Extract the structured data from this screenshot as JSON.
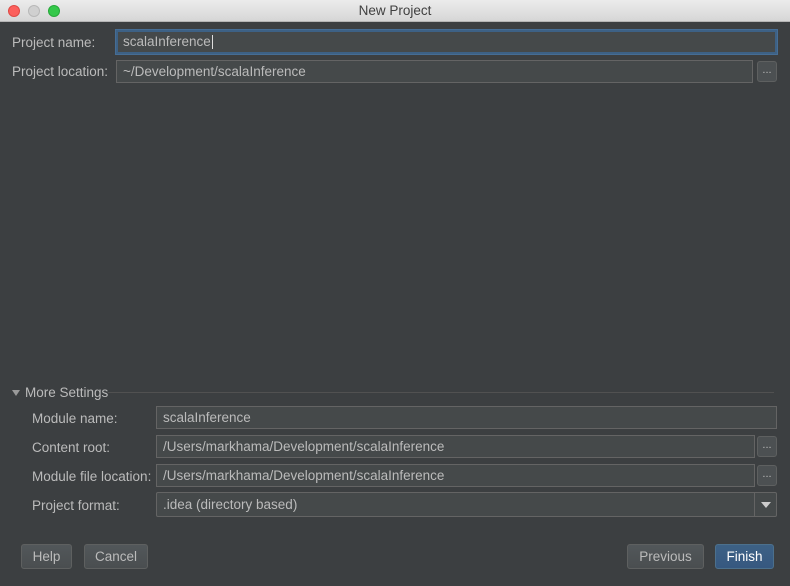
{
  "window": {
    "title": "New Project"
  },
  "form": {
    "project_name_label": "Project name:",
    "project_name_value": "scalaInference",
    "project_location_label": "Project location:",
    "project_location_value": "~/Development/scalaInference",
    "browse_label": "..."
  },
  "more_settings": {
    "header": "More Settings",
    "expanded": true,
    "module_name_label": "Module name:",
    "module_name_value": "scalaInference",
    "content_root_label": "Content root:",
    "content_root_value": "/Users/markhama/Development/scalaInference",
    "module_file_location_label": "Module file location:",
    "module_file_location_value": "/Users/markhama/Development/scalaInference",
    "project_format_label": "Project format:",
    "project_format_value": ".idea (directory based)"
  },
  "buttons": {
    "help": "Help",
    "cancel": "Cancel",
    "previous": "Previous",
    "finish": "Finish"
  },
  "colors": {
    "background": "#3c3f41",
    "field_background": "#45494a",
    "focus_border": "#3d6185",
    "primary_button": "#365880",
    "text": "#bbbbbb"
  },
  "icons": {
    "close": "traffic-light-close",
    "minimize": "traffic-light-minimize",
    "maximize": "traffic-light-maximize",
    "expand": "disclosure-triangle-down",
    "dropdown": "chevron-down"
  }
}
